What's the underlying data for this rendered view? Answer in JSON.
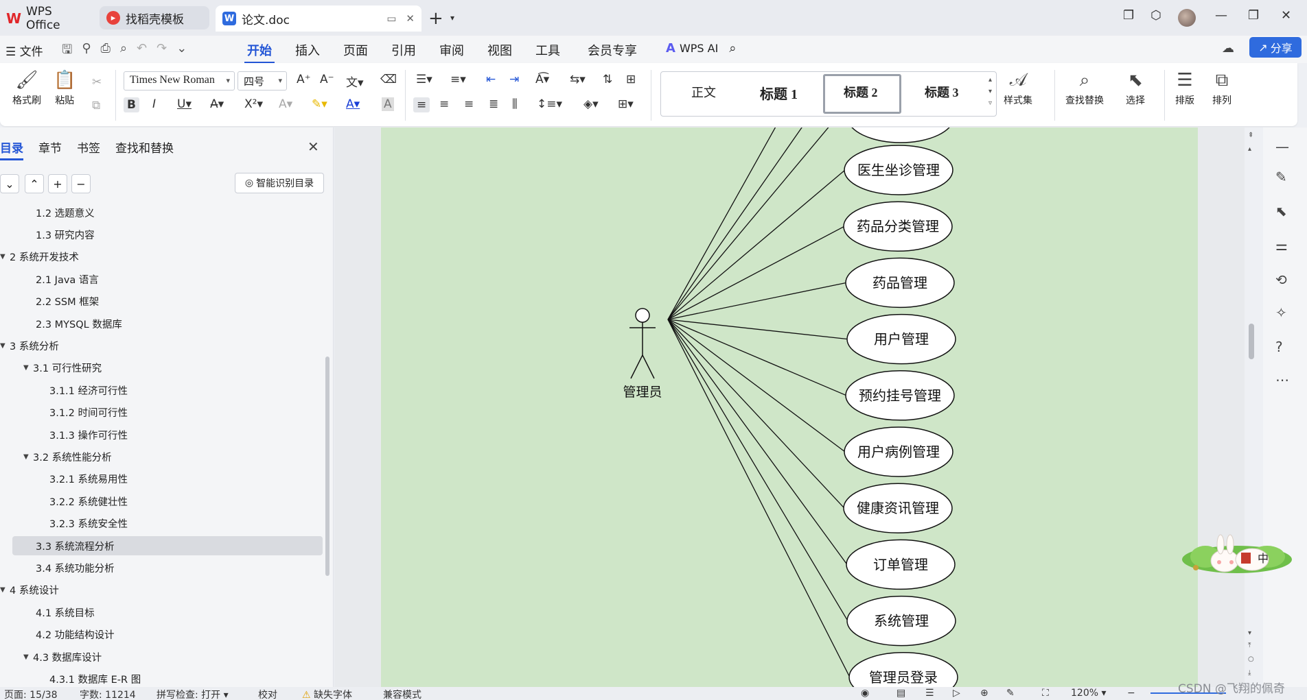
{
  "titlebar": {
    "tabs": [
      {
        "label": "WPS Office"
      },
      {
        "label": "找稻壳模板"
      },
      {
        "label": "论文.doc"
      }
    ]
  },
  "menubar": {
    "file": "文件",
    "items": [
      "开始",
      "插入",
      "页面",
      "引用",
      "审阅",
      "视图",
      "工具",
      "会员专享"
    ],
    "active": "开始",
    "ai": "WPS AI",
    "share": "分享"
  },
  "ribbon": {
    "format_painter": "格式刷",
    "paste": "粘贴",
    "font_name": "Times New Roman",
    "font_size": "四号",
    "styles": {
      "normal": "正文",
      "h1": "标题 1",
      "h2": "标题 2",
      "h3": "标题 3"
    },
    "style_set": "样式集",
    "find_replace": "查找替换",
    "select": "选择",
    "layout": "排版",
    "arrange": "排列"
  },
  "nav": {
    "tabs": [
      "目录",
      "章节",
      "书签",
      "查找和替换"
    ],
    "smart_toc": "智能识别目录",
    "toc": [
      {
        "text": "1.2  选题意义",
        "level": 2
      },
      {
        "text": "1.3  研究内容",
        "level": 2
      },
      {
        "text": "2  系统开发技术",
        "level": 1
      },
      {
        "text": "2.1 Java 语言",
        "level": 2
      },
      {
        "text": "2.2 SSM 框架",
        "level": 2
      },
      {
        "text": "2.3 MYSQL 数据库",
        "level": 2
      },
      {
        "text": "3  系统分析",
        "level": 1
      },
      {
        "text": "3.1 可行性研究",
        "level": 2,
        "expandable": true
      },
      {
        "text": "3.1.1 经济可行性",
        "level": 3
      },
      {
        "text": "3.1.2 时间可行性",
        "level": 3
      },
      {
        "text": "3.1.3 操作可行性",
        "level": 3
      },
      {
        "text": "3.2 系统性能分析",
        "level": 2,
        "expandable": true
      },
      {
        "text": "3.2.1 系统易用性",
        "level": 3
      },
      {
        "text": "3.2.2 系统健壮性",
        "level": 3
      },
      {
        "text": "3.2.3 系统安全性",
        "level": 3
      },
      {
        "text": "3.3  系统流程分析",
        "level": 2,
        "current": true
      },
      {
        "text": "3.4 系统功能分析",
        "level": 2
      },
      {
        "text": "4  系统设计",
        "level": 1
      },
      {
        "text": "4.1 系统目标",
        "level": 2
      },
      {
        "text": "4.2 功能结构设计",
        "level": 2
      },
      {
        "text": "4.3 数据库设计",
        "level": 2,
        "expandable": true
      },
      {
        "text": "4.3.1 数据库 E-R 图",
        "level": 3
      }
    ]
  },
  "diagram": {
    "actor": "管理员",
    "use_cases": [
      "医生坐诊管理",
      "药品分类管理",
      "药品管理",
      "用户管理",
      "预约挂号管理",
      "用户病例管理",
      "健康资讯管理",
      "订单管理",
      "系统管理",
      "管理员登录"
    ]
  },
  "statusbar": {
    "page": "页面: 15/38",
    "words": "字数: 11214",
    "spellcheck": "拼写检查: 打开",
    "proofread": "校对",
    "missing_font": "缺失字体",
    "compat": "兼容模式",
    "zoom": "120%"
  },
  "mascot_text": "中",
  "watermark": "CSDN @飞翔的佩奇"
}
